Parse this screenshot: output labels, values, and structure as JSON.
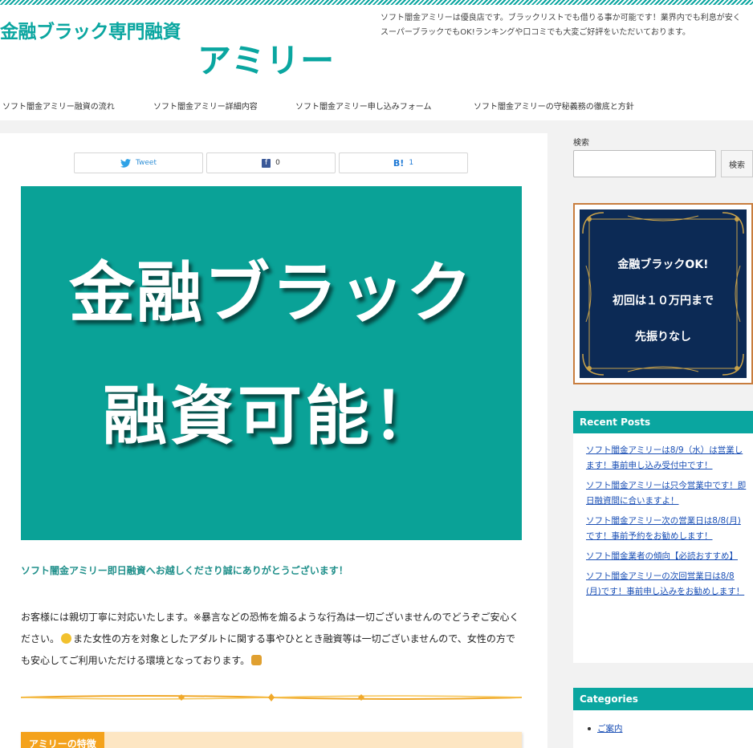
{
  "header": {
    "logo_line1": "金融ブラック専門融資",
    "logo_line2": "アミリー",
    "description": "ソフト闇金アミリーは優良店です。ブラックリストでも借りる事か可能です！業界内でも利息が安くスーパーブラックでもOK!ランキングや口コミでも大変ご好評をいただいております。"
  },
  "nav": {
    "items": [
      {
        "label": "ソフト闇金アミリー融資の流れ"
      },
      {
        "label": "ソフト闇金アミリー詳細内容"
      },
      {
        "label": "ソフト闇金アミリー申し込みフォーム"
      },
      {
        "label": "ソフト闇金アミリーの守秘義務の徹底と方針"
      }
    ]
  },
  "share": {
    "tweet_label": "Tweet",
    "facebook_count": "0",
    "hatena_label": "B!",
    "hatena_count": "1"
  },
  "hero": {
    "line1": "金融ブラック",
    "line2": "融資可能！",
    "background": "#0aa297"
  },
  "article": {
    "lead": "ソフト闇金アミリー即日融資へお越しくださり誠にありがとうございます！",
    "body_part1": "お客様には親切丁寧に対応いたします。※暴言などの恐怖を煽るような行為は一切ございませんのでどうぞご安心ください。",
    "body_part2": "また女性の方を対象としたアダルトに関する事やひととき融資等は一切ございませんので、女性の方でも安心してご利用いただける環境となっております。",
    "feature_label": "アミリーの特徴"
  },
  "sidebar": {
    "search_label": "検索",
    "search_value": "",
    "search_button": "検索",
    "banner": {
      "line1": "金融ブラックOK!",
      "line2": "初回は１０万円まで",
      "line3": "先振りなし"
    },
    "recent_title": "Recent Posts",
    "recent_posts": [
      {
        "title": "ソフト闇金アミリーは8/9（水）は営業します！事前申し込み受付中です！"
      },
      {
        "title": "ソフト闇金アミリーは只今営業中です！即日融資間に合いますよ！"
      },
      {
        "title": "ソフト闇金アミリー次の営業日は8/8(月)です！事前予約をお勧めします！"
      },
      {
        "title": "ソフト闇金業者の傾向【必読おすすめ】"
      },
      {
        "title": "ソフト闇金アミリーの次回営業日は8/8(月)です！事前申し込みをお勧めします！"
      }
    ],
    "categories_title": "Categories",
    "categories": [
      {
        "label": "ご案内"
      }
    ]
  },
  "colors": {
    "accent": "#0aa6a0",
    "link": "#1a4fb5",
    "feature_bg": "#fde6c3",
    "feature_label": "#f4a21c",
    "banner_bg": "#0c2a55",
    "banner_border": "#c87d3e"
  }
}
